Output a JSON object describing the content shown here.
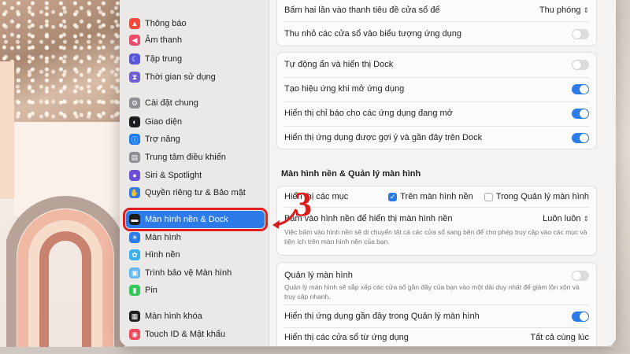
{
  "sidebar": {
    "items": [
      {
        "label": "Thông báo",
        "icon": "bell-icon",
        "color": "#f04a3d"
      },
      {
        "label": "Âm thanh",
        "icon": "speaker-icon",
        "color": "#f04a6a"
      },
      {
        "label": "Tập trung",
        "icon": "moon-icon",
        "color": "#5856d6"
      },
      {
        "label": "Thời gian sử dụng",
        "icon": "hourglass-icon",
        "color": "#6e5fd4"
      },
      {
        "label": "Cài đặt chung",
        "icon": "gear-icon",
        "color": "#8e8e93"
      },
      {
        "label": "Giao diện",
        "icon": "appearance-icon",
        "color": "#1c1c1e"
      },
      {
        "label": "Trợ năng",
        "icon": "accessibility-icon",
        "color": "#1a7cf0"
      },
      {
        "label": "Trung tâm điều khiển",
        "icon": "control-center-icon",
        "color": "#8e8e93"
      },
      {
        "label": "Siri & Spotlight",
        "icon": "siri-icon",
        "color": "#6b4fd8"
      },
      {
        "label": "Quyền riêng tư & Bảo mật",
        "icon": "hand-icon",
        "color": "#2f7cf0"
      },
      {
        "label": "Màn hình nền & Dock",
        "icon": "dock-icon",
        "color": "#1c1c1e",
        "selected": true
      },
      {
        "label": "Màn hình",
        "icon": "sun-icon",
        "color": "#2c7be8"
      },
      {
        "label": "Hình nền",
        "icon": "flower-icon",
        "color": "#3ab0f0"
      },
      {
        "label": "Trình bảo vệ Màn hình",
        "icon": "screensaver-icon",
        "color": "#5fb8f5"
      },
      {
        "label": "Pin",
        "icon": "battery-icon",
        "color": "#34c759"
      },
      {
        "label": "Màn hình khóa",
        "icon": "lock-screen-icon",
        "color": "#1c1c1e"
      },
      {
        "label": "Touch ID & Mật khẩu",
        "icon": "fingerprint-icon",
        "color": "#f04a5a"
      }
    ]
  },
  "group1": {
    "row1": {
      "label": "Bấm hai lần vào thanh tiêu đề cửa sổ để",
      "value": "Thu phóng"
    },
    "row2": {
      "label": "Thu nhỏ các cửa sổ vào biểu tượng ứng dụng",
      "on": false
    }
  },
  "group2": {
    "rows": [
      {
        "label": "Tự động ẩn và hiển thị Dock",
        "on": false
      },
      {
        "label": "Tạo hiệu ứng khi mở ứng dụng",
        "on": true
      },
      {
        "label": "Hiển thị chỉ báo cho các ứng dụng đang mở",
        "on": true
      },
      {
        "label": "Hiển thị ứng dụng được gợi ý và gần đây trên Dock",
        "on": true
      }
    ]
  },
  "desktop_heading": "Màn hình nền & Quản lý màn hình",
  "group3": {
    "show_items_label": "Hiển thị các mục",
    "on_desktop": "Trên màn hình nền",
    "in_stage_manager": "Trong Quản lý màn hình",
    "click_wallpaper_label": "Bấm vào hình nền để hiển thị màn hình nền",
    "click_wallpaper_value": "Luôn luôn",
    "click_wallpaper_desc": "Việc bấm vào hình nền sẽ di chuyển tất cả các cửa sổ sang bên để cho phép truy cập vào các mục và tiện ích trên màn hình nền của bạn."
  },
  "group4": {
    "stage_manager_label": "Quản lý màn hình",
    "stage_manager_desc": "Quản lý màn hình sẽ sắp xếp các cửa sổ gần đây của bạn vào một dải duy nhất để giảm lộn xộn và truy cập nhanh.",
    "recent_apps_label": "Hiển thị ứng dụng gần đây trong Quản lý màn hình",
    "partial_label": "Hiển thị các cửa sổ từ ứng dụng",
    "partial_value": "Tất cả cùng lúc"
  },
  "annotation": {
    "number": "3"
  }
}
